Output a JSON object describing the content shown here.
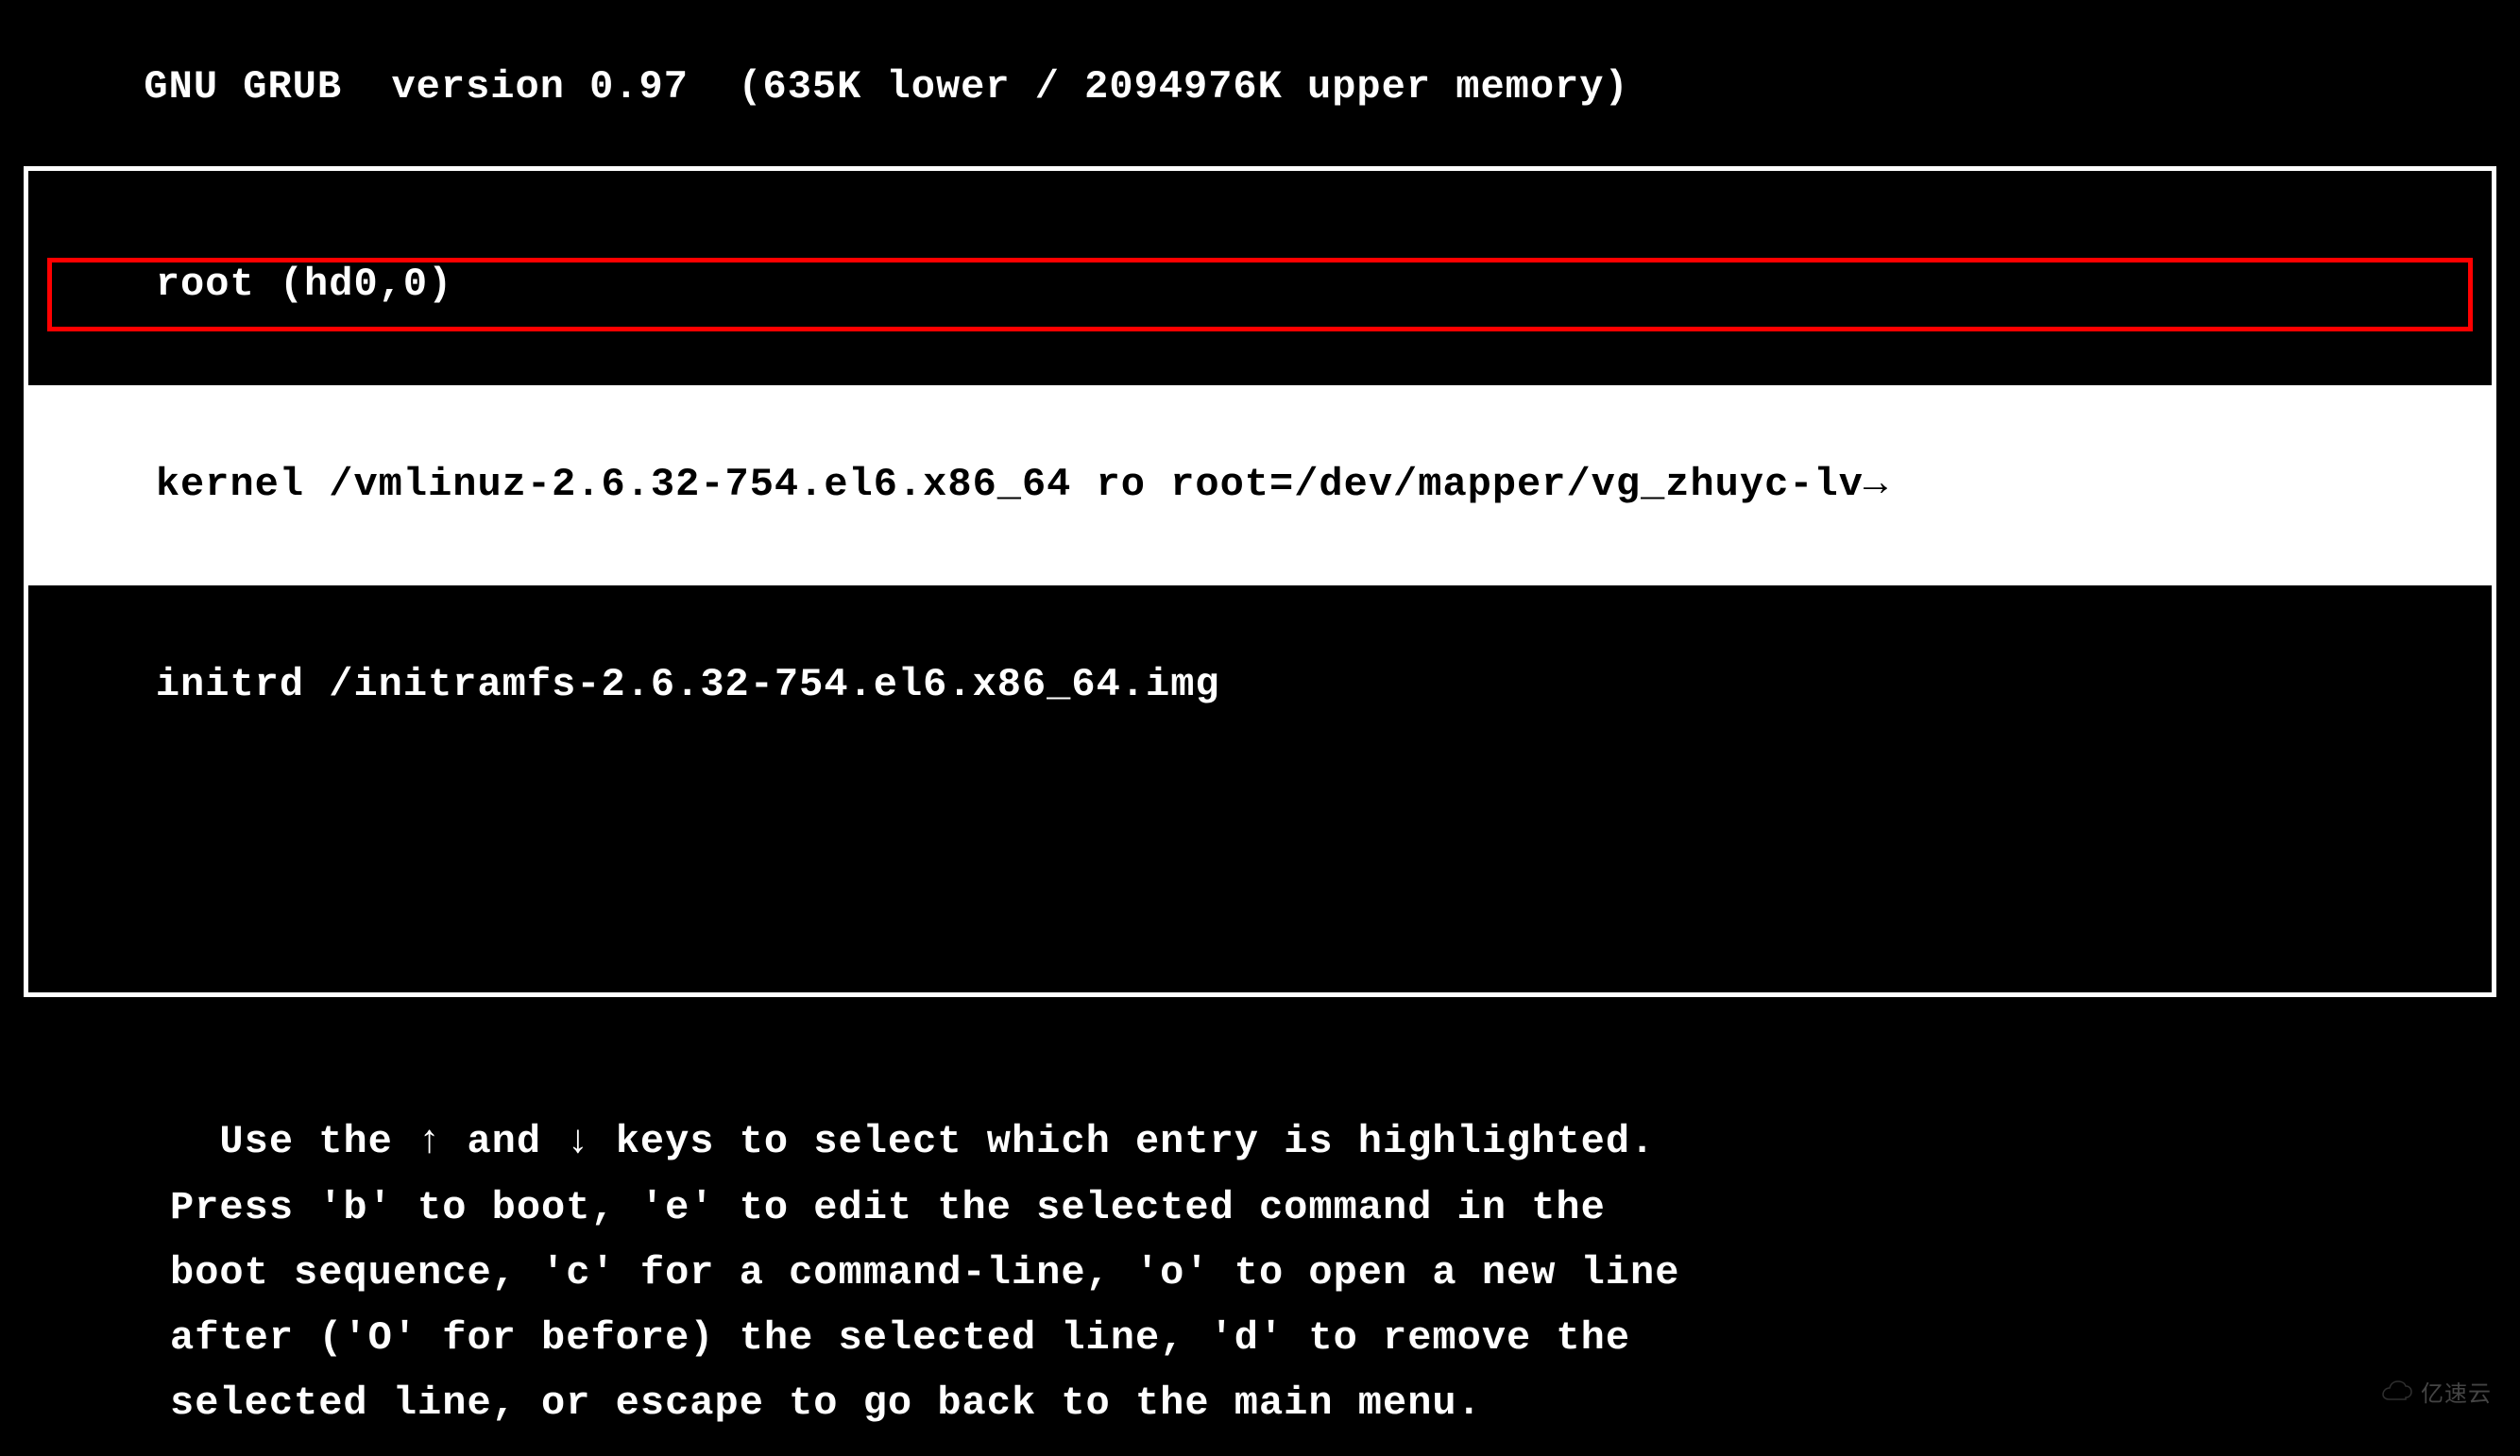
{
  "header": {
    "title": "GNU GRUB  version 0.97  (635K lower / 2094976K upper memory)"
  },
  "menu": {
    "entries": [
      {
        "text": "root (hd0,0)",
        "selected": false
      },
      {
        "text": "kernel /vmlinuz-2.6.32-754.el6.x86_64 ro root=/dev/mapper/vg_zhuyc-lv→",
        "selected": true,
        "highlighted": true
      },
      {
        "text": "initrd /initramfs-2.6.32-754.el6.x86_64.img",
        "selected": false
      }
    ]
  },
  "instructions": {
    "text": "Use the ↑ and ↓ keys to select which entry is highlighted.\nPress 'b' to boot, 'e' to edit the selected command in the\nboot sequence, 'c' for a command-line, 'o' to open a new line\nafter ('O' for before) the selected line, 'd' to remove the\nselected line, or escape to go back to the main menu."
  },
  "watermark": {
    "text": "亿速云"
  }
}
